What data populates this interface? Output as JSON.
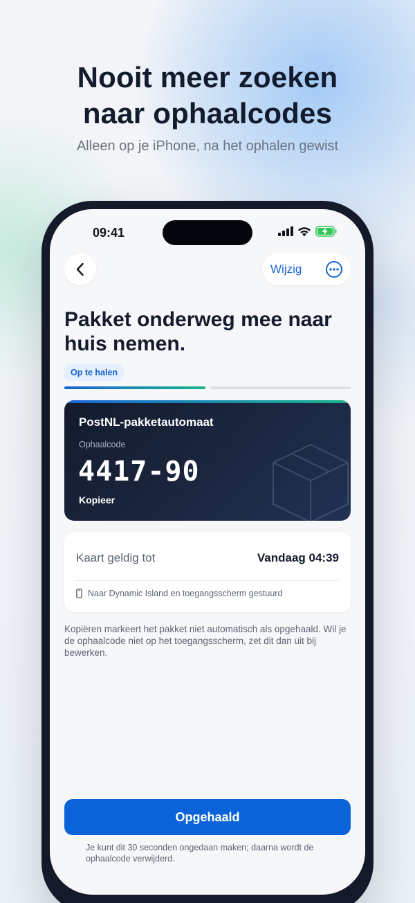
{
  "hero": {
    "title_line1": "Nooit meer zoeken",
    "title_line2": "naar ophaalcodes",
    "subtitle": "Alleen op je iPhone, na het ophalen gewist"
  },
  "status_bar": {
    "time": "09:41",
    "icons": [
      "signal-icon",
      "wifi-icon",
      "battery-charging-icon"
    ]
  },
  "nav": {
    "back_icon": "chevron-left-icon",
    "edit_label": "Wijzig",
    "more_icon": "more-horizontal-circle-icon"
  },
  "page": {
    "title": "Pakket onderweg mee naar huis nemen.",
    "status_chip": "Op te halen",
    "progress_steps_done": 1,
    "progress_steps_total": 2
  },
  "code_card": {
    "title": "PostNL-pakketautomaat",
    "code_label": "Ophaalcode",
    "code": "4417-90",
    "copy_label": "Kopieer"
  },
  "info_card": {
    "label": "Kaart geldig tot",
    "value": "Vandaag 04:39",
    "note": "Naar Dynamic Island en toegangsscherm gestuurd",
    "note_icon": "phone-icon"
  },
  "help_text": "Kopiëren markeert het pakket niet automatisch als opgehaald. Wil je de ophaalcode niet op het toegangsscherm, zet dit dan uit bij bewerken.",
  "primary_button": "Opgehaald",
  "footnote": "Je kunt dit 30 seconden ongedaan maken; daarna wordt de ophaalcode verwijderd.",
  "colors": {
    "accent": "#0b63d9",
    "dark_text": "#131b2c",
    "card_dark": "#1b2740",
    "success": "#34c759"
  }
}
